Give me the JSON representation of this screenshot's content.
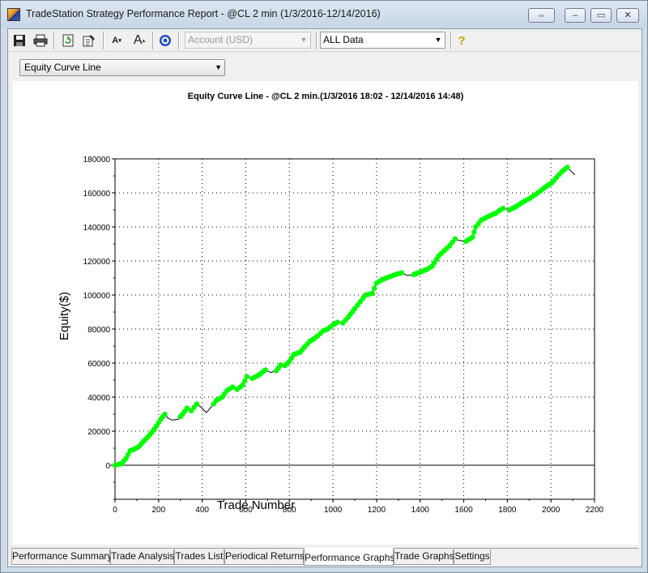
{
  "window": {
    "title": "TradeStation Strategy Performance Report - @CL 2 min (1/3/2016-12/14/2016)",
    "buttons": [
      "⇔",
      "–",
      "▭",
      "✕"
    ]
  },
  "toolbar": {
    "account_value": "Account (USD)",
    "range_value": "ALL Data",
    "icons": [
      "save-icon",
      "print-icon",
      "refresh-icon",
      "properties-icon",
      "font-decrease-icon",
      "font-increase-icon",
      "target-icon",
      "help-icon"
    ],
    "font_small": "A",
    "font_large": "A",
    "help": "?"
  },
  "view_selector": {
    "value": "Equity Curve Line"
  },
  "tabs": [
    {
      "label": "Performance Summary",
      "active": false
    },
    {
      "label": "Trade Analysis",
      "active": false
    },
    {
      "label": "Trades List",
      "active": false
    },
    {
      "label": "Periodical Returns",
      "active": false
    },
    {
      "label": "Performance Graphs",
      "active": true
    },
    {
      "label": "Trade Graphs",
      "active": false
    },
    {
      "label": "Settings",
      "active": false
    }
  ],
  "chart_data": {
    "type": "line",
    "title": "Equity Curve Line - @CL 2 min.(1/3/2016 18:02 - 12/14/2016 14:48)",
    "xlabel": "Trade Number",
    "ylabel": "Equity($)",
    "xlim": [
      0,
      2200
    ],
    "ylim": [
      -20000,
      180000
    ],
    "x_ticks": [
      "0",
      "200",
      "400",
      "600",
      "800",
      "1000",
      "1200",
      "1400",
      "1600",
      "1800",
      "2000",
      "2200"
    ],
    "y_ticks": [
      "0",
      "20000",
      "40000",
      "60000",
      "80000",
      "100000",
      "120000",
      "140000",
      "160000",
      "180000"
    ],
    "grid": "dotted",
    "colors": {
      "new_high": "#00ff00",
      "equity_line": "#000000"
    },
    "series": [
      {
        "values": [
          [
            0,
            0
          ],
          [
            30,
            1000
          ],
          [
            50,
            4000
          ],
          [
            70,
            8500
          ],
          [
            90,
            9500
          ],
          [
            110,
            11000
          ],
          [
            130,
            14000
          ],
          [
            150,
            16500
          ],
          [
            170,
            19500
          ],
          [
            190,
            23000
          ],
          [
            210,
            27000
          ],
          [
            228,
            30000
          ],
          [
            240,
            28000
          ],
          [
            260,
            26500
          ],
          [
            290,
            27000
          ],
          [
            310,
            30000
          ],
          [
            330,
            33500
          ],
          [
            350,
            32000
          ],
          [
            375,
            36000
          ],
          [
            395,
            34000
          ],
          [
            420,
            31000
          ],
          [
            440,
            34000
          ],
          [
            465,
            38000
          ],
          [
            490,
            40000
          ],
          [
            515,
            44000
          ],
          [
            540,
            46000
          ],
          [
            560,
            44500
          ],
          [
            585,
            47000
          ],
          [
            605,
            52000
          ],
          [
            630,
            51000
          ],
          [
            660,
            53000
          ],
          [
            690,
            56000
          ],
          [
            715,
            54500
          ],
          [
            740,
            55500
          ],
          [
            760,
            59000
          ],
          [
            780,
            58500
          ],
          [
            800,
            61000
          ],
          [
            820,
            65000
          ],
          [
            850,
            66500
          ],
          [
            870,
            69500
          ],
          [
            895,
            73000
          ],
          [
            910,
            74000
          ],
          [
            930,
            76000
          ],
          [
            955,
            79000
          ],
          [
            975,
            80000
          ],
          [
            1000,
            82500
          ],
          [
            1020,
            84000
          ],
          [
            1045,
            83500
          ],
          [
            1070,
            87000
          ],
          [
            1100,
            92000
          ],
          [
            1125,
            96000
          ],
          [
            1150,
            100000
          ],
          [
            1180,
            101000
          ],
          [
            1200,
            107000
          ],
          [
            1225,
            109000
          ],
          [
            1255,
            110500
          ],
          [
            1285,
            112000
          ],
          [
            1315,
            113000
          ],
          [
            1340,
            111500
          ],
          [
            1370,
            112000
          ],
          [
            1400,
            113500
          ],
          [
            1430,
            115000
          ],
          [
            1455,
            117000
          ],
          [
            1485,
            123000
          ],
          [
            1510,
            126000
          ],
          [
            1535,
            129000
          ],
          [
            1560,
            133000
          ],
          [
            1580,
            132000
          ],
          [
            1610,
            131500
          ],
          [
            1640,
            134000
          ],
          [
            1655,
            140000
          ],
          [
            1680,
            144000
          ],
          [
            1710,
            146000
          ],
          [
            1745,
            148000
          ],
          [
            1780,
            151000
          ],
          [
            1810,
            150000
          ],
          [
            1840,
            152000
          ],
          [
            1870,
            154500
          ],
          [
            1905,
            157000
          ],
          [
            1940,
            160000
          ],
          [
            1975,
            163500
          ],
          [
            2005,
            166000
          ],
          [
            2025,
            169000
          ],
          [
            2050,
            172500
          ],
          [
            2075,
            175000
          ],
          [
            2090,
            173000
          ],
          [
            2110,
            170500
          ]
        ]
      }
    ]
  }
}
